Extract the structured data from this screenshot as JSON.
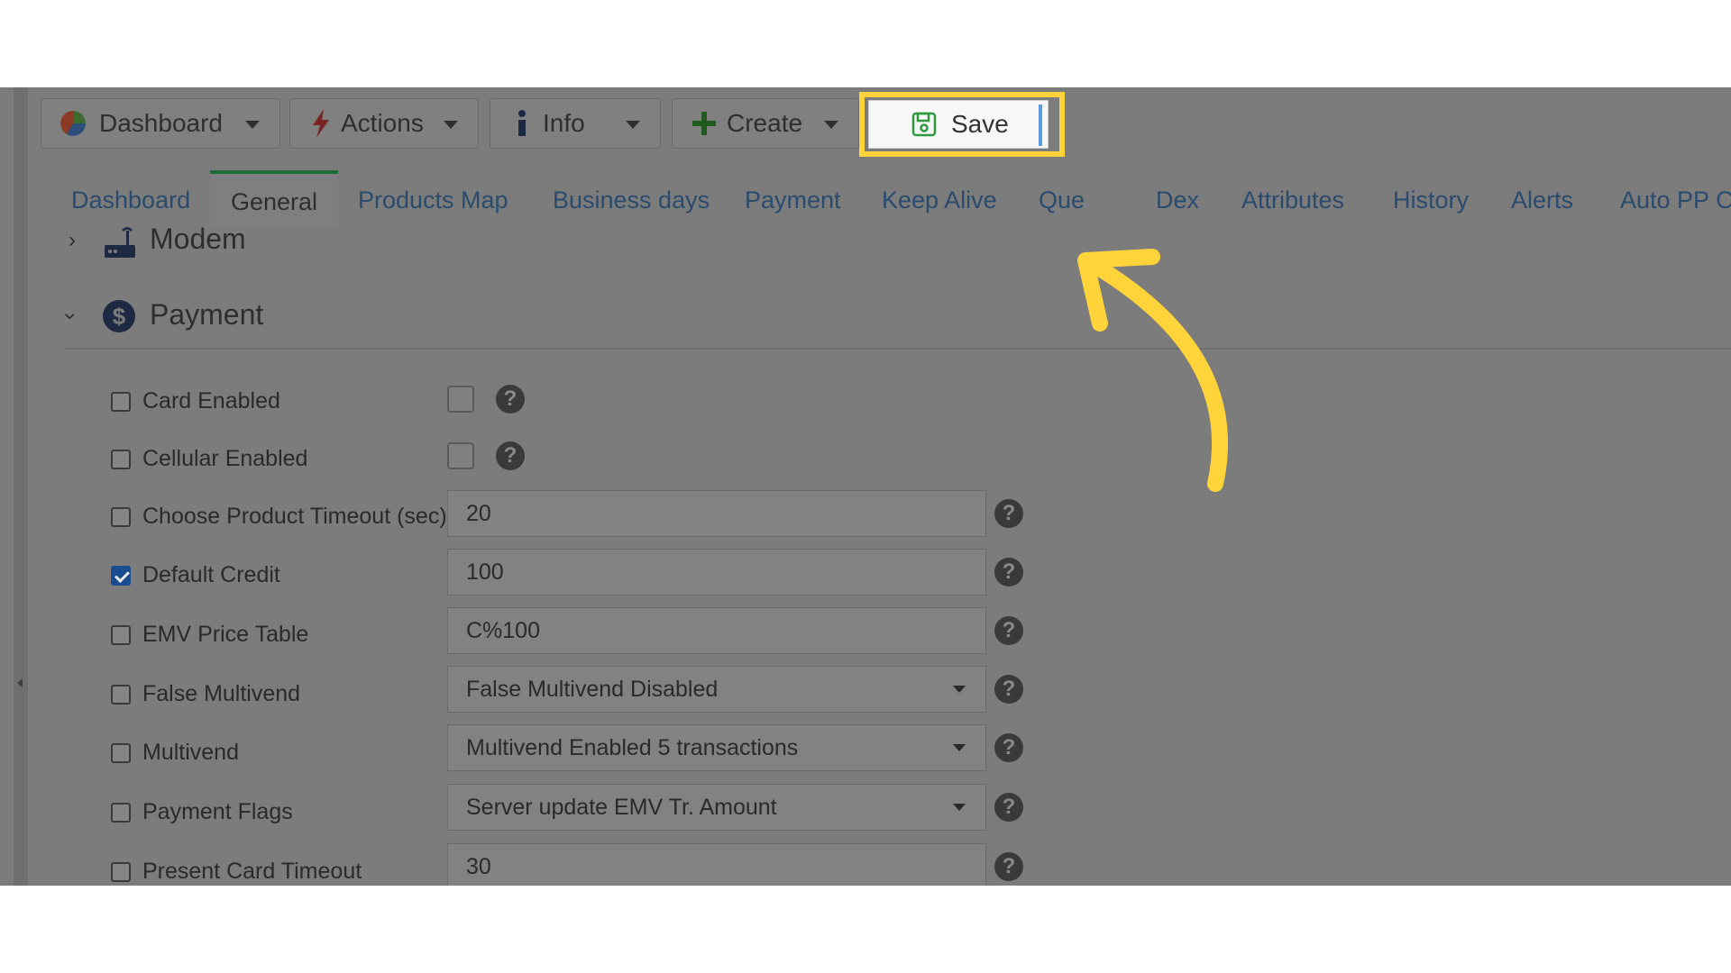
{
  "toolbar": {
    "dashboard": "Dashboard",
    "actions": "Actions",
    "info": "Info",
    "create": "Create",
    "save": "Save"
  },
  "tabs": [
    {
      "label": "Dashboard"
    },
    {
      "label": "General"
    },
    {
      "label": "Products Map"
    },
    {
      "label": "Business days"
    },
    {
      "label": "Payment"
    },
    {
      "label": "Keep Alive"
    },
    {
      "label": "Que"
    },
    {
      "label": "Dex"
    },
    {
      "label": "Attributes"
    },
    {
      "label": "History"
    },
    {
      "label": "Alerts"
    },
    {
      "label": "Auto PP C"
    }
  ],
  "sections": {
    "modem": "Modem",
    "payment": "Payment"
  },
  "rows": [
    {
      "label": "Card Enabled",
      "checked": false,
      "type": "checkbox"
    },
    {
      "label": "Cellular Enabled",
      "checked": false,
      "type": "checkbox"
    },
    {
      "label": "Choose Product Timeout (sec)",
      "checked": false,
      "type": "text",
      "value": "20"
    },
    {
      "label": "Default Credit",
      "checked": true,
      "type": "text",
      "value": "100"
    },
    {
      "label": "EMV Price Table",
      "checked": false,
      "type": "text",
      "value": "C%100"
    },
    {
      "label": "False Multivend",
      "checked": false,
      "type": "select",
      "value": "False Multivend Disabled"
    },
    {
      "label": "Multivend",
      "checked": false,
      "type": "select",
      "value": "Multivend Enabled 5 transactions"
    },
    {
      "label": "Payment Flags",
      "checked": false,
      "type": "select",
      "value": "Server update EMV Tr. Amount"
    },
    {
      "label": "Present Card Timeout",
      "checked": false,
      "type": "text",
      "value": "30"
    }
  ],
  "colors": {
    "highlight": "#ffd43a",
    "active_tab_border": "#1f6b3a",
    "overlay": "#7c7c7c"
  }
}
